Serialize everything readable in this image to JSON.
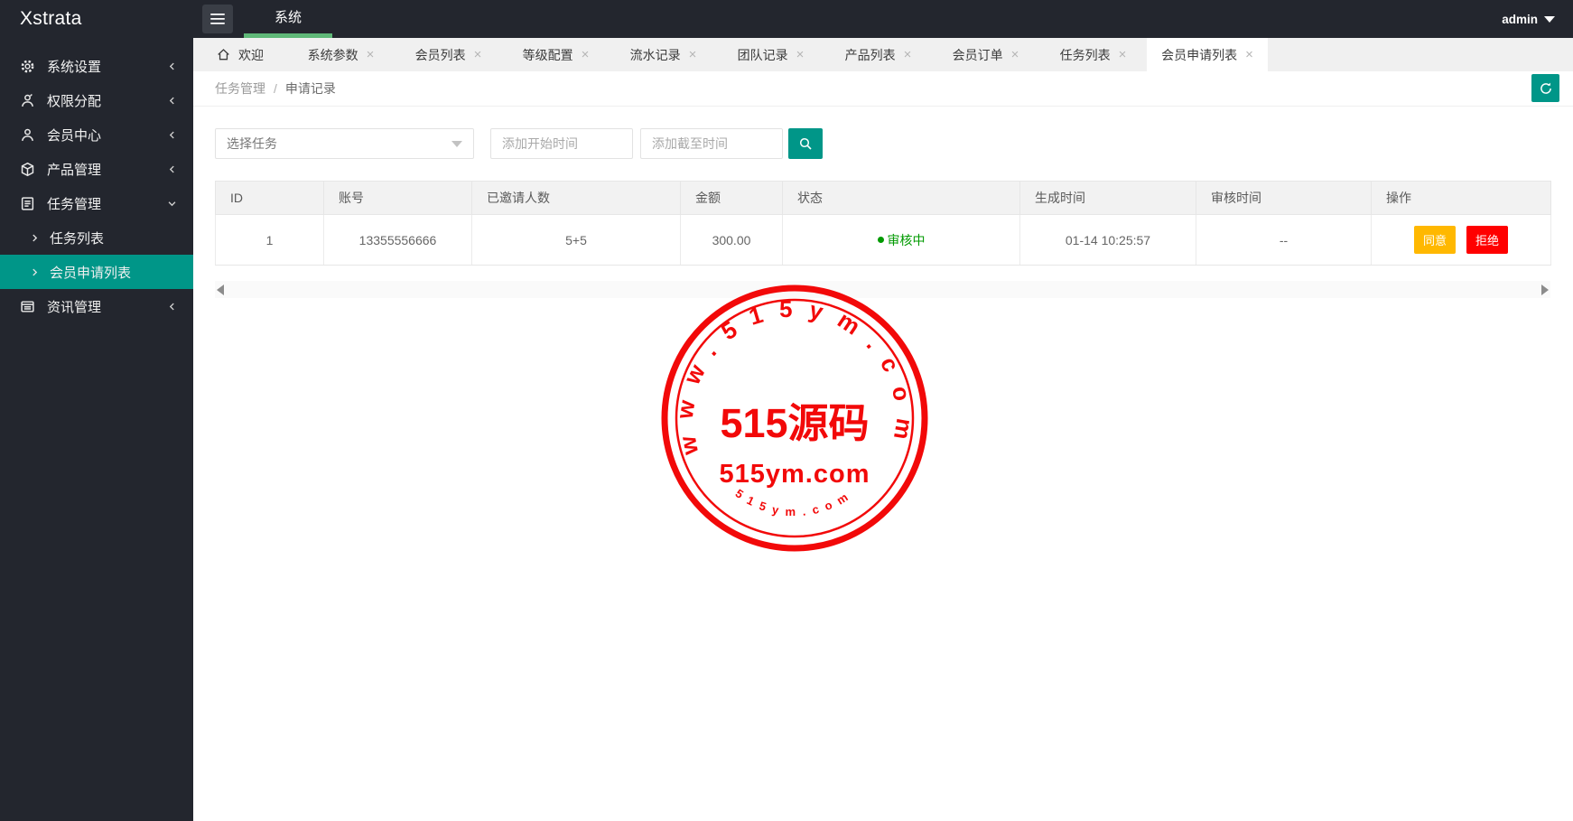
{
  "header": {
    "logo": "Xstrata",
    "nav_tab": "系统",
    "user": "admin"
  },
  "sidebar": {
    "items": [
      {
        "icon": "gear-icon",
        "label": "系统设置",
        "state": "collapsed"
      },
      {
        "icon": "permissions-icon",
        "label": "权限分配",
        "state": "collapsed"
      },
      {
        "icon": "member-icon",
        "label": "会员中心",
        "state": "collapsed"
      },
      {
        "icon": "product-icon",
        "label": "产品管理",
        "state": "collapsed"
      },
      {
        "icon": "task-icon",
        "label": "任务管理",
        "state": "expanded",
        "children": [
          {
            "label": "任务列表",
            "active": false
          },
          {
            "label": "会员申请列表",
            "active": true
          }
        ]
      },
      {
        "icon": "news-icon",
        "label": "资讯管理",
        "state": "collapsed"
      }
    ]
  },
  "tabbar": {
    "close_glyph": "×",
    "tabs": [
      {
        "label": "欢迎",
        "closable": false,
        "active": false
      },
      {
        "label": "系统参数",
        "closable": true,
        "active": false
      },
      {
        "label": "会员列表",
        "closable": true,
        "active": false
      },
      {
        "label": "等级配置",
        "closable": true,
        "active": false
      },
      {
        "label": "流水记录",
        "closable": true,
        "active": false
      },
      {
        "label": "团队记录",
        "closable": true,
        "active": false
      },
      {
        "label": "产品列表",
        "closable": true,
        "active": false
      },
      {
        "label": "会员订单",
        "closable": true,
        "active": false
      },
      {
        "label": "任务列表",
        "closable": true,
        "active": false
      },
      {
        "label": "会员申请列表",
        "closable": true,
        "active": true
      }
    ]
  },
  "toolbar": {
    "breadcrumb": [
      "任务管理",
      "申请记录"
    ],
    "separator": "/"
  },
  "filters": {
    "task_placeholder": "选择任务",
    "start_placeholder": "添加开始时间",
    "end_placeholder": "添加截至时间"
  },
  "table": {
    "columns": [
      "ID",
      "账号",
      "已邀请人数",
      "金额",
      "状态",
      "生成时间",
      "审核时间",
      "操作"
    ],
    "rows": [
      {
        "id": "1",
        "account": "13355556666",
        "invited_count": "5+5",
        "amount": "300.00",
        "status": "审核中",
        "created_at": "01-14 10:25:57",
        "reviewed_at": "--"
      }
    ],
    "actions": {
      "approve": "同意",
      "reject": "拒绝"
    }
  },
  "watermark": {
    "arc_top": "www.515ym.com",
    "title": "515源码",
    "subtitle": "515ym.com",
    "arc_bottom": "515ym.com",
    "color": "#f20000"
  },
  "colors": {
    "teal_accent": "#009688",
    "green_underline": "#5FB878",
    "dark_chrome": "#23262e",
    "amount_red": "#ff0000",
    "status_green": "#009a00",
    "approve_amber": "#ffb800",
    "reject_red": "#ff0000",
    "stamp_red": "#f20000"
  }
}
